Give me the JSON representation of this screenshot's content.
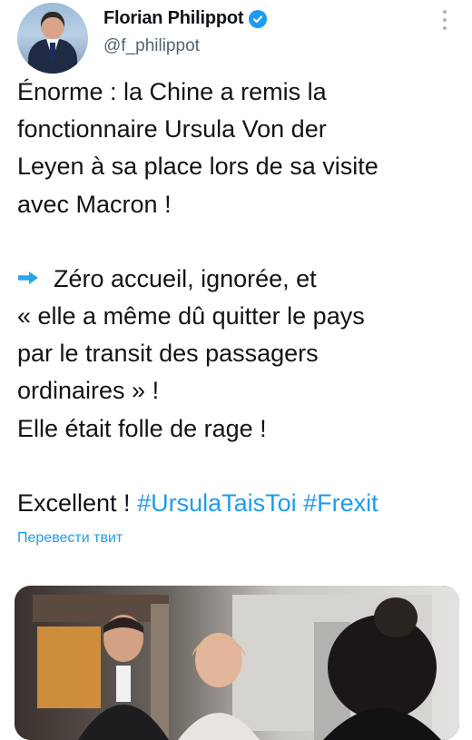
{
  "author": {
    "name": "Florian Philippot",
    "handle": "@f_philippot",
    "verified": true,
    "avatar_icon": "profile-photo"
  },
  "menu_icon": "more-vertical-icon",
  "tweet": {
    "lines": [
      "Énorme : la Chine a remis la",
      "fonctionnaire Ursula Von der",
      "Leyen à sa place lors de sa visite",
      "avec Macron !",
      "",
      "Zéro accueil, ignorée, et",
      "« elle a même dû quitter le pays",
      "par le transit des passagers",
      "ordinaires » !",
      "Elle était folle de rage !",
      "",
      "Excellent ! "
    ],
    "arrow_icon": "right-arrow-emoji",
    "hashtags": [
      "#UrsulaTaisToi",
      "#Frexit"
    ]
  },
  "translate_label": "Перевести твит",
  "colors": {
    "link": "#1d9bf0",
    "text": "#0f1419",
    "muted": "#536471",
    "verified": "#1d9bf0"
  },
  "media": {
    "type": "photo"
  }
}
